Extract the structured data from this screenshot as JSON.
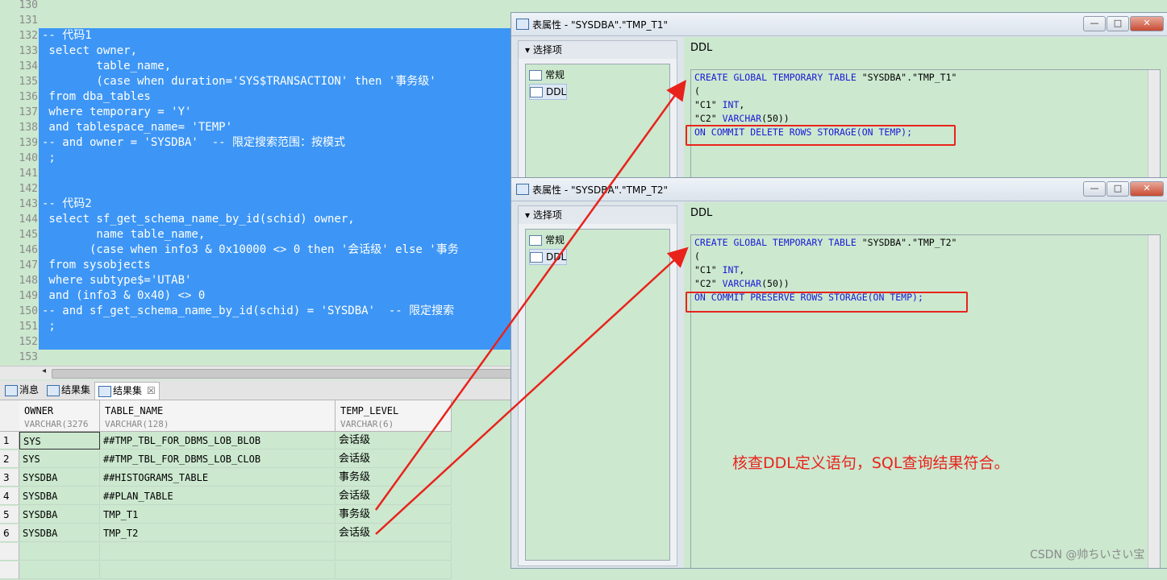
{
  "editor": {
    "lines": [
      {
        "n": "130",
        "code": "",
        "sel": false
      },
      {
        "n": "131",
        "code": "",
        "sel": false
      },
      {
        "n": "132",
        "code": "-- 代码1",
        "sel": true
      },
      {
        "n": "133",
        "code": " select owner,",
        "sel": true
      },
      {
        "n": "134",
        "code": "        table_name,",
        "sel": true
      },
      {
        "n": "135",
        "code": "        (case when duration='SYS$TRANSACTION' then '事务级'",
        "sel": true
      },
      {
        "n": "136",
        "code": " from dba_tables",
        "sel": true
      },
      {
        "n": "137",
        "code": " where temporary = 'Y'",
        "sel": true
      },
      {
        "n": "138",
        "code": " and tablespace_name= 'TEMP'",
        "sel": true
      },
      {
        "n": "139",
        "code": "-- and owner = 'SYSDBA'  -- 限定搜索范围：按模式",
        "sel": true
      },
      {
        "n": "140",
        "code": " ;",
        "sel": true
      },
      {
        "n": "141",
        "code": "",
        "sel": true
      },
      {
        "n": "142",
        "code": "",
        "sel": true
      },
      {
        "n": "143",
        "code": "-- 代码2",
        "sel": true
      },
      {
        "n": "144",
        "code": " select sf_get_schema_name_by_id(schid) owner,",
        "sel": true
      },
      {
        "n": "145",
        "code": "        name table_name,",
        "sel": true
      },
      {
        "n": "146",
        "code": "       (case when info3 & 0x10000 <> 0 then '会话级' else '事务",
        "sel": true
      },
      {
        "n": "147",
        "code": " from sysobjects",
        "sel": true
      },
      {
        "n": "148",
        "code": " where subtype$='UTAB'",
        "sel": true
      },
      {
        "n": "149",
        "code": " and (info3 & 0x40) <> 0",
        "sel": true
      },
      {
        "n": "150",
        "code": "-- and sf_get_schema_name_by_id(schid) = 'SYSDBA'  -- 限定搜索",
        "sel": true
      },
      {
        "n": "151",
        "code": " ;",
        "sel": true
      },
      {
        "n": "152",
        "code": "",
        "sel": true
      },
      {
        "n": "153",
        "code": "",
        "sel": false
      }
    ]
  },
  "result_tabs": [
    {
      "label": "消息",
      "active": false
    },
    {
      "label": "结果集",
      "active": false
    },
    {
      "label": "结果集",
      "active": true
    }
  ],
  "result_grid": {
    "columns": [
      {
        "name": "OWNER",
        "type": "VARCHAR(3276"
      },
      {
        "name": "TABLE_NAME",
        "type": "VARCHAR(128)"
      },
      {
        "name": "TEMP_LEVEL",
        "type": "VARCHAR(6)"
      }
    ],
    "rows": [
      {
        "n": "1",
        "owner": "SYS",
        "table": "##TMP_TBL_FOR_DBMS_LOB_BLOB",
        "level": "会话级"
      },
      {
        "n": "2",
        "owner": "SYS",
        "table": "##TMP_TBL_FOR_DBMS_LOB_CLOB",
        "level": "会话级"
      },
      {
        "n": "3",
        "owner": "SYSDBA",
        "table": "##HISTOGRAMS_TABLE",
        "level": "事务级"
      },
      {
        "n": "4",
        "owner": "SYSDBA",
        "table": "##PLAN_TABLE",
        "level": "会话级"
      },
      {
        "n": "5",
        "owner": "SYSDBA",
        "table": "TMP_T1",
        "level": "事务级"
      },
      {
        "n": "6",
        "owner": "SYSDBA",
        "table": "TMP_T2",
        "level": "会话级"
      }
    ]
  },
  "window1": {
    "title": "表属性 - \"SYSDBA\".\"TMP_T1\"",
    "options_label": "选择项",
    "items": [
      "常规",
      "DDL"
    ],
    "ddl_label": "DDL",
    "ddl": {
      "l1_kw": "CREATE GLOBAL TEMPORARY TABLE",
      "l1_rest": " \"SYSDBA\".\"TMP_T1\"",
      "l2": "(",
      "l3_a": "\"C1\" ",
      "l3_b": "INT",
      ",": ",",
      "l4_a": "\"C2\" ",
      "l4_b": "VARCHAR",
      "l4_c": "(50))",
      "l5": "ON COMMIT DELETE ROWS STORAGE(ON TEMP);"
    }
  },
  "window2": {
    "title": "表属性 - \"SYSDBA\".\"TMP_T2\"",
    "options_label": "选择项",
    "items": [
      "常规",
      "DDL"
    ],
    "ddl_label": "DDL",
    "ddl": {
      "l1_kw": "CREATE GLOBAL TEMPORARY TABLE",
      "l1_rest": " \"SYSDBA\".\"TMP_T2\"",
      "l2": "(",
      "l3_a": "\"C1\" ",
      "l3_b": "INT",
      "l4_a": "\"C2\" ",
      "l4_b": "VARCHAR",
      "l4_c": "(50))",
      "l5": "ON COMMIT PRESERVE ROWS STORAGE(ON TEMP);"
    }
  },
  "window_buttons": {
    "min": "—",
    "max": "□",
    "close": "✕"
  },
  "annotation": "核查DDL定义语句，SQL查询结果符合。",
  "watermark": "CSDN @帅ちいさい宝",
  "colors": {
    "editor_bg": "#cce8cf",
    "selection": "#3d96f5",
    "keyword": "#1a1ad6",
    "annotation": "#e8231c"
  }
}
